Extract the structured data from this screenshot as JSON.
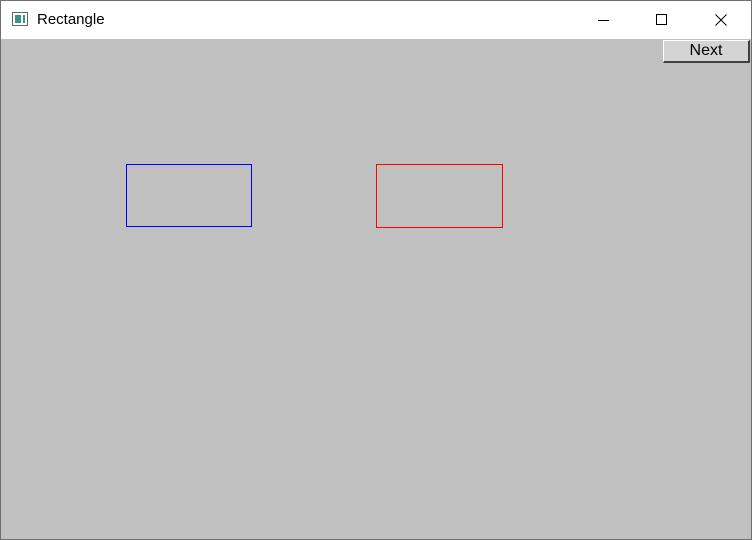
{
  "window": {
    "title": "Rectangle",
    "background_color": "#c0c0c0",
    "titlebar_color": "#ffffff"
  },
  "titlebar": {
    "app_icon": "window-app-icon",
    "controls": {
      "minimize_icon": "minimize-icon",
      "maximize_icon": "maximize-icon",
      "close_icon": "close-icon"
    }
  },
  "toolbar": {
    "next_label": "Next"
  },
  "canvas": {
    "shapes": [
      {
        "name": "blue-rectangle",
        "type": "rectangle-outline",
        "stroke_color": "#0000ff"
      },
      {
        "name": "red-rectangle",
        "type": "rectangle-outline",
        "stroke_color": "#ff0000"
      }
    ]
  }
}
